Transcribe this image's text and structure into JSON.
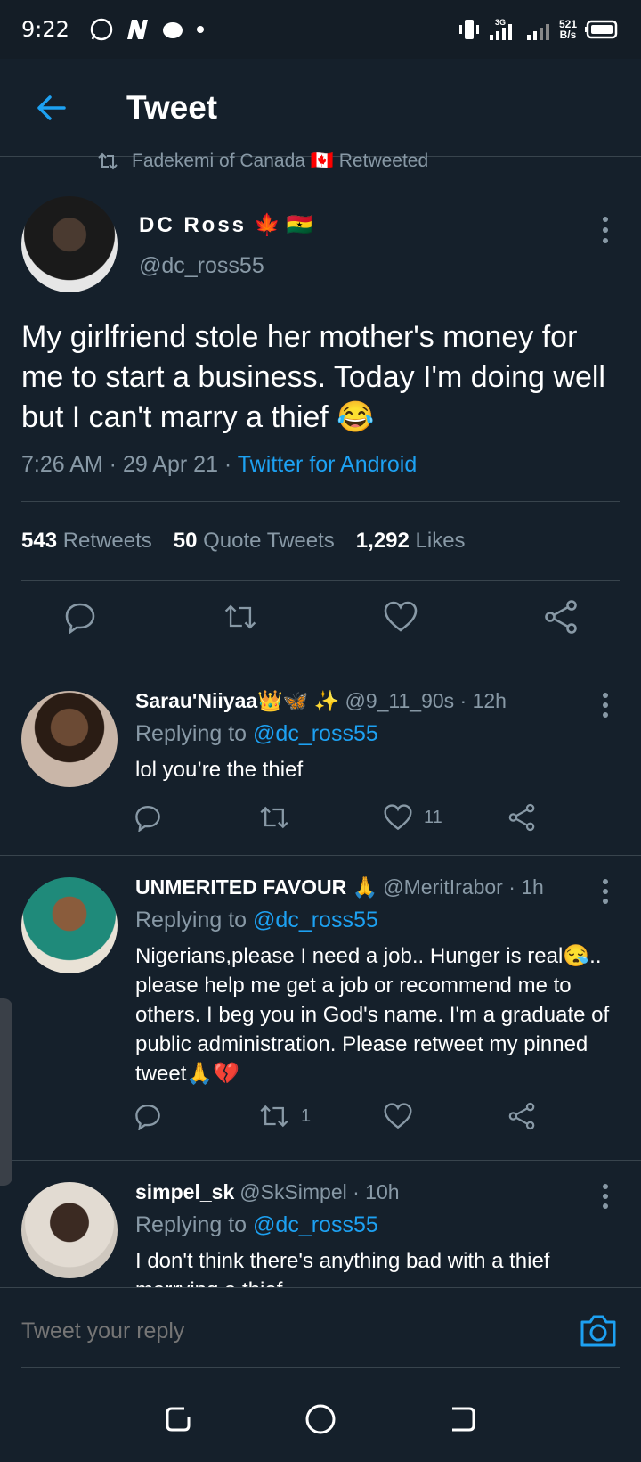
{
  "status_bar": {
    "time": "9:22",
    "net_type": "3G",
    "rate_value": "521",
    "rate_unit": "B/s"
  },
  "header": {
    "title": "Tweet"
  },
  "retweeted_by": "Fadekemi of Canada 🇨🇦 Retweeted",
  "main_tweet": {
    "name": "DC Ross",
    "name_emoji": "🍁 🇬🇭",
    "handle": "@dc_ross55",
    "text": "My girlfriend stole her mother's money for me to start a business. Today I'm doing well but I can't marry a thief 😂",
    "time": "7:26 AM · 29 Apr 21 · ",
    "source": "Twitter for Android",
    "retweets_count": "543",
    "retweets_label": "Retweets",
    "quotes_count": "50",
    "quotes_label": "Quote Tweets",
    "likes_count": "1,292",
    "likes_label": "Likes"
  },
  "replies": [
    {
      "name": "Sarau'Niiyaa👑🦋 ✨",
      "handle_time": "@9_11_90s · 12h",
      "replying_prefix": "Replying to ",
      "replying_to": "@dc_ross55",
      "text": "lol you’re the thief",
      "retweets": "",
      "likes": "11"
    },
    {
      "name": "UNMERITED FAVOUR 🙏",
      "handle_time": "@MeritIrabor · 1h",
      "replying_prefix": "Replying to ",
      "replying_to": "@dc_ross55",
      "text": "Nigerians,please I need a job.. Hunger is real😪.. please help me get a job or recommend me to others. I beg you in God's name. I'm a graduate of public administration. Please retweet my pinned tweet🙏💔",
      "retweets": "1",
      "likes": ""
    },
    {
      "name": "simpel_sk",
      "handle_time": "@SkSimpel · 10h",
      "replying_prefix": "Replying to ",
      "replying_to": "@dc_ross55",
      "text": "I don't think there's anything bad with a thief marrying a thief",
      "retweets": "",
      "likes": ""
    }
  ],
  "reply_bar": {
    "placeholder": "Tweet your reply"
  },
  "colors": {
    "background": "#15202b",
    "accent": "#1da1f2",
    "muted": "#8899a6",
    "divider": "#38444d"
  },
  "icons": [
    "back-arrow-icon",
    "more-vertical-icon",
    "reply-icon",
    "retweet-icon",
    "like-icon",
    "share-icon",
    "camera-icon",
    "recent-apps-icon",
    "home-icon",
    "back-nav-icon"
  ]
}
